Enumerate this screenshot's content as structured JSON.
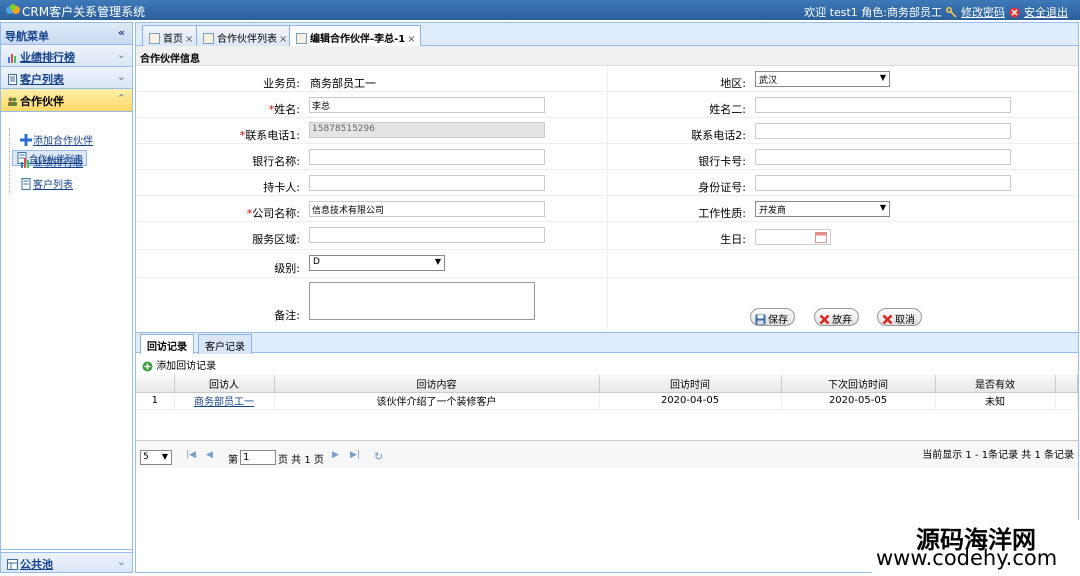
{
  "header": {
    "app_title": "CRM客户关系管理系统",
    "welcome": "欢迎 test1 角色:商务部员工",
    "change_password": "修改密码",
    "logout": "安全退出"
  },
  "sidebar": {
    "title": "导航菜单",
    "sections": [
      {
        "label": "业绩排行榜"
      },
      {
        "label": "客户列表"
      },
      {
        "label": "合作伙伴"
      }
    ],
    "items": [
      {
        "label": "添加合作伙伴"
      },
      {
        "label": "合作伙伴列表"
      },
      {
        "label": "业绩排行版"
      },
      {
        "label": "客户列表"
      }
    ],
    "bottom": "公共池"
  },
  "tabs": [
    {
      "label": "首页"
    },
    {
      "label": "合作伙伴列表"
    },
    {
      "label": "编辑合作伙伴-李总-1"
    }
  ],
  "form": {
    "section_title": "合作伙伴信息",
    "salesman_label": "业务员:",
    "salesman_value": "商务部员工一",
    "region_label": "地区:",
    "region_value": "武汉",
    "name_label": "姓名:",
    "name_value": "李总",
    "name2_label": "姓名二:",
    "phone1_label": "联系电话1:",
    "phone1_value": "15878515296",
    "phone2_label": "联系电话2:",
    "bank_name_label": "银行名称:",
    "bank_card_label": "银行卡号:",
    "card_holder_label": "持卡人:",
    "id_no_label": "身份证号:",
    "company_label": "公司名称:",
    "company_value": "信息技术有限公司",
    "work_type_label": "工作性质:",
    "work_type_value": "开发商",
    "service_area_label": "服务区域:",
    "birthday_label": "生日:",
    "level_label": "级别:",
    "level_value": "D",
    "remark_label": "备注:",
    "required_mark": "*",
    "save": "保存",
    "abandon": "放弃",
    "cancel": "取消"
  },
  "subtabs": [
    {
      "label": "回访记录"
    },
    {
      "label": "客户记录"
    }
  ],
  "visit": {
    "add_label": "添加回访记录",
    "columns": [
      "回访人",
      "回访内容",
      "回访时间",
      "下次回访时间",
      "是否有效"
    ],
    "rows": [
      {
        "no": "1",
        "visitor": "商务部员工一",
        "content": "该伙伴介绍了一个装修客户",
        "time": "2020-04-05",
        "next_time": "2020-05-05",
        "valid": "未知"
      }
    ]
  },
  "pager": {
    "page_size": "5",
    "page_prefix": "第",
    "page_value": "1",
    "page_suffix": "页 共 1 页",
    "summary": "当前显示 1 - 1条记录 共 1 条记录"
  },
  "watermark": {
    "line1": "源码海洋网",
    "line2": "www.codehy.com"
  }
}
